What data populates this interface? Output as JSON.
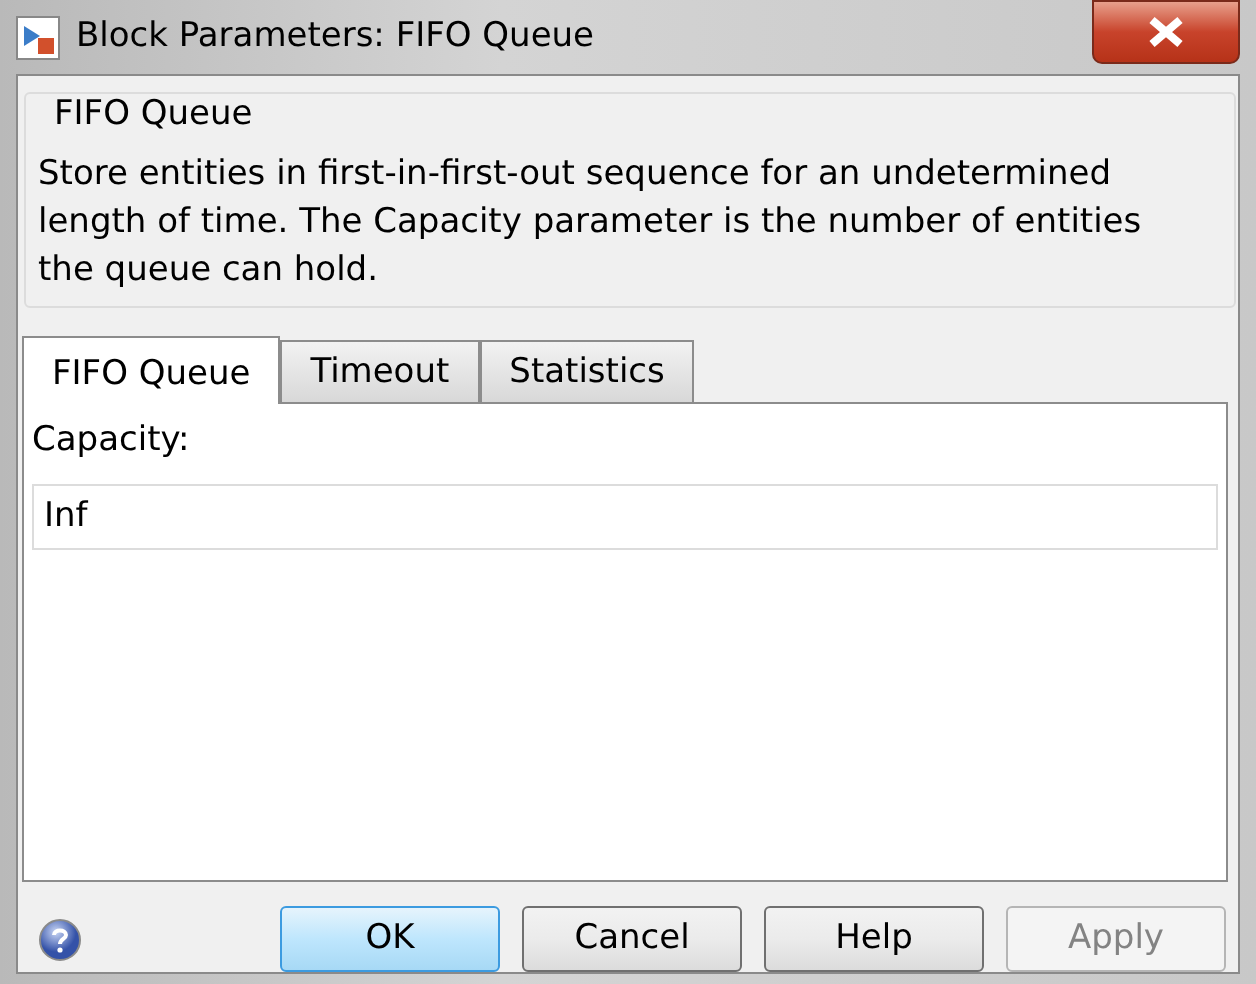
{
  "window": {
    "title": "Block Parameters: FIFO Queue"
  },
  "description": {
    "title": "FIFO Queue",
    "text": "Store entities in first-in-first-out sequence for an undetermined length of time. The Capacity parameter is the number of entities the queue can hold."
  },
  "tabs": [
    {
      "label": "FIFO Queue",
      "selected": true
    },
    {
      "label": "Timeout",
      "selected": false
    },
    {
      "label": "Statistics",
      "selected": false
    }
  ],
  "fields": [
    {
      "label": "Capacity:",
      "value": "Inf"
    }
  ],
  "buttons": [
    {
      "label": "OK",
      "default": true,
      "disabled": false
    },
    {
      "label": "Cancel",
      "default": false,
      "disabled": false
    },
    {
      "label": "Help",
      "default": false,
      "disabled": false
    },
    {
      "label": "Apply",
      "default": false,
      "disabled": true
    }
  ]
}
